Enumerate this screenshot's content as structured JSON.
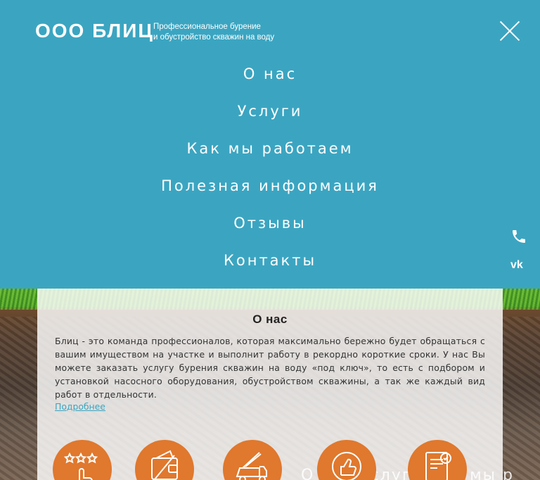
{
  "header": {
    "logo": "ООО БЛИЦ",
    "tagline_line1": "Профессиональное бурение",
    "tagline_line2": "и обустройство скважин на воду"
  },
  "menu": {
    "items": [
      {
        "label": "О нас"
      },
      {
        "label": "Услуги"
      },
      {
        "label": "Как мы работаем"
      },
      {
        "label": "Полезная информация"
      },
      {
        "label": "Отзывы"
      },
      {
        "label": "Контакты"
      }
    ]
  },
  "side": {
    "phone_icon": "phone-icon",
    "vk_label": "vk"
  },
  "about": {
    "title": "О нас",
    "text": "Блиц - это команда профессионалов, которая максимально бережно будет обращаться с вашим имуществом на участке и выполнит работу в рекордно короткие сроки. У нас Вы можете заказать услугу бурения скважин на воду «под ключ», то есть с подбором и установкой насосного оборудования, обустройством скважины, а так же каждый вид работ в отдельности.",
    "more": "Подробнее"
  },
  "features": {
    "icons": [
      "rating-stars-icon",
      "wallet-icon",
      "drilling-truck-icon",
      "thumbs-up-badge-icon",
      "certificate-icon"
    ],
    "accent": "#e0782d"
  },
  "ghost_nav": "О нас   Услуги   Как мы р",
  "colors": {
    "primary": "#3ba5c1",
    "text": "#333333",
    "accent": "#e0782d"
  }
}
